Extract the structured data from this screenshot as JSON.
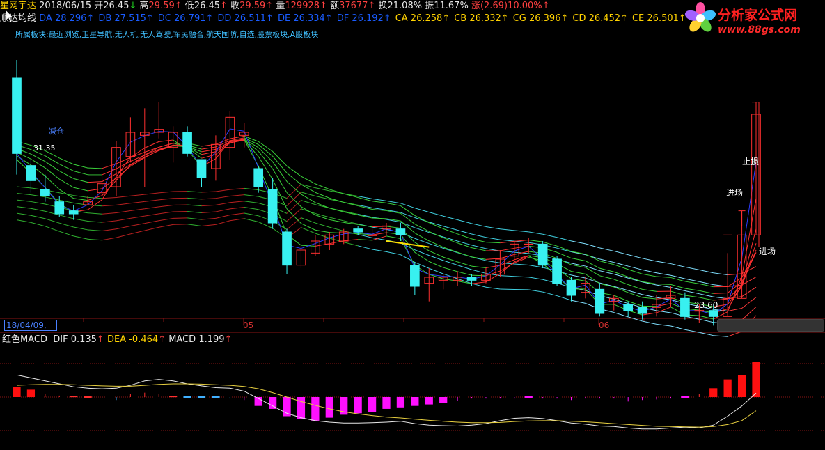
{
  "header": {
    "security_name": "星网宇达",
    "date": "2018/06/15",
    "open_label": "开",
    "open_value": "26.45",
    "high_label": "高",
    "high_value": "29.59",
    "low_label": "低",
    "low_value": "26.45",
    "close_label": "收",
    "close_value": "29.59",
    "volume_label": "量",
    "volume_value": "129928",
    "amount_label": "额",
    "amount_value": "37677",
    "turnover_label": "换",
    "turnover_value": "21.08%",
    "amplitude_label": "振",
    "amplitude_value": "11.67%",
    "change_label": "涨",
    "change_value": "(2.69)10.00%"
  },
  "indicator_line": {
    "name": "顺达均线",
    "items": [
      {
        "label": "DA",
        "value": "28.296"
      },
      {
        "label": "DB",
        "value": "27.515"
      },
      {
        "label": "DC",
        "value": "26.791"
      },
      {
        "label": "DD",
        "value": "26.511"
      },
      {
        "label": "DE",
        "value": "26.334"
      },
      {
        "label": "DF",
        "value": "26.192"
      },
      {
        "label": "CA",
        "value": "26.258"
      },
      {
        "label": "CB",
        "value": "26.332"
      },
      {
        "label": "CG",
        "value": "26.396"
      },
      {
        "label": "CD",
        "value": "26.452"
      },
      {
        "label": "CE",
        "value": "26.501"
      },
      {
        "label": "CF",
        "value": ""
      }
    ]
  },
  "sector_line": "所属板块:最近浏览,卫星导航,无人机,无人驾驶,军民融合,航天国防,自选,股票板块,A股板块",
  "logo": {
    "title": "分析家公式网",
    "url": "www.88gs.com"
  },
  "annotations": {
    "reduce": "减仓",
    "high_price": "31.35",
    "low_price": "23.60",
    "stop_loss": "止损",
    "enter1": "进场",
    "enter2": "进场"
  },
  "time_axis": {
    "cursor_date": "18/04/09,一",
    "month1": "05",
    "month2": "06"
  },
  "macd": {
    "name": "红色MACD",
    "dif_label": "DIF",
    "dif_value": "0.135",
    "dea_label": "DEA",
    "dea_value": "-0.464",
    "macd_label": "MACD",
    "macd_value": "1.199"
  },
  "colors": {
    "up": "#ff3030",
    "down": "#38f0f0",
    "bg": "#000000",
    "divider": "#8a1414",
    "macd_pos": "#ff1010",
    "macd_neg": "#ff10ff"
  },
  "chart_data": {
    "type": "candlestick",
    "price_range": [
      23.0,
      32.0
    ],
    "candles": [
      [
        30.8,
        28.3,
        31.4,
        27.6
      ],
      [
        27.9,
        27.4,
        28.1,
        27.0
      ],
      [
        27.1,
        26.9,
        27.6,
        26.7
      ],
      [
        26.7,
        26.3,
        26.9,
        26.2
      ],
      [
        26.4,
        26.3,
        26.6,
        26.1
      ],
      [
        26.6,
        26.7,
        26.9,
        26.6
      ],
      [
        27.0,
        27.3,
        27.6,
        26.9
      ],
      [
        27.2,
        28.5,
        28.7,
        26.9
      ],
      [
        28.2,
        29.0,
        29.5,
        28.0
      ],
      [
        28.9,
        29.0,
        29.8,
        27.2
      ],
      [
        29.0,
        29.1,
        30.0,
        28.8
      ],
      [
        28.5,
        29.0,
        29.2,
        28.0
      ],
      [
        29.0,
        28.3,
        29.2,
        28.2
      ],
      [
        28.1,
        27.5,
        28.1,
        27.2
      ],
      [
        27.8,
        28.6,
        28.9,
        27.4
      ],
      [
        28.5,
        29.5,
        29.7,
        28.1
      ],
      [
        28.9,
        29.0,
        29.3,
        28.5
      ],
      [
        27.8,
        27.2,
        27.9,
        27.0
      ],
      [
        27.1,
        26.0,
        27.5,
        25.8
      ],
      [
        25.7,
        24.6,
        25.8,
        24.3
      ],
      [
        24.6,
        25.1,
        25.3,
        24.5
      ],
      [
        25.0,
        25.4,
        25.6,
        24.9
      ],
      [
        25.3,
        25.6,
        25.7,
        25.1
      ],
      [
        25.4,
        25.7,
        25.8,
        25.3
      ],
      [
        25.8,
        25.7,
        25.9,
        25.6
      ],
      [
        25.6,
        25.6,
        25.8,
        25.5
      ],
      [
        25.8,
        25.9,
        26.0,
        25.6
      ],
      [
        25.8,
        25.6,
        26.0,
        25.4
      ],
      [
        24.6,
        23.9,
        24.7,
        23.6
      ],
      [
        24.0,
        24.2,
        24.5,
        23.4
      ],
      [
        24.1,
        24.2,
        24.3,
        23.8
      ],
      [
        24.1,
        24.2,
        24.4,
        23.9
      ],
      [
        24.2,
        24.1,
        24.3,
        23.9
      ],
      [
        24.1,
        24.3,
        24.5,
        24.0
      ],
      [
        24.3,
        24.8,
        25.1,
        24.2
      ],
      [
        24.9,
        25.3,
        25.4,
        24.8
      ],
      [
        25.3,
        25.3,
        25.5,
        25.0
      ],
      [
        25.3,
        24.6,
        25.4,
        24.5
      ],
      [
        24.8,
        24.0,
        24.9,
        23.9
      ],
      [
        24.1,
        23.6,
        24.2,
        23.4
      ],
      [
        23.7,
        24.0,
        24.2,
        23.5
      ],
      [
        23.8,
        23.0,
        24.0,
        22.9
      ],
      [
        23.4,
        23.5,
        23.6,
        23.1
      ],
      [
        23.3,
        23.1,
        23.4,
        22.9
      ],
      [
        23.2,
        23.0,
        23.4,
        22.8
      ],
      [
        23.2,
        23.3,
        23.6,
        22.9
      ],
      [
        23.5,
        23.6,
        23.9,
        23.2
      ],
      [
        23.5,
        22.9,
        23.7,
        22.8
      ],
      [
        23.1,
        23.1,
        23.3,
        22.7
      ],
      [
        23.1,
        22.9,
        23.3,
        22.6
      ],
      [
        22.9,
        23.5,
        25.0,
        22.9
      ],
      [
        23.5,
        25.6,
        26.4,
        23.5
      ],
      [
        25.6,
        29.6,
        30.0,
        25.6
      ]
    ],
    "macd_hist": [
      0.35,
      0.25,
      0.1,
      0.05,
      0.02,
      0.0,
      -0.05,
      -0.1,
      0.1,
      0.15,
      0.1,
      0.02,
      -0.02,
      -0.02,
      -0.02,
      -0.05,
      -0.1,
      -0.3,
      -0.4,
      -0.65,
      -0.75,
      -0.8,
      -0.7,
      -0.6,
      -0.55,
      -0.5,
      -0.4,
      -0.35,
      -0.3,
      -0.25,
      -0.2,
      -0.12,
      -0.05,
      -0.05,
      -0.05,
      -0.05,
      -0.02,
      -0.05,
      -0.05,
      -0.1,
      -0.05,
      -0.05,
      -0.05,
      -0.15,
      -0.1,
      -0.08,
      -0.05,
      -0.03,
      0.1,
      0.3,
      0.6,
      0.75,
      1.2
    ],
    "dif": [
      0.75,
      0.65,
      0.55,
      0.45,
      0.35,
      0.3,
      0.28,
      0.3,
      0.4,
      0.55,
      0.6,
      0.55,
      0.45,
      0.38,
      0.32,
      0.3,
      0.2,
      -0.05,
      -0.3,
      -0.55,
      -0.7,
      -0.8,
      -0.85,
      -0.88,
      -0.88,
      -0.87,
      -0.85,
      -0.82,
      -0.9,
      -0.95,
      -0.97,
      -0.98,
      -0.95,
      -0.9,
      -0.8,
      -0.72,
      -0.7,
      -0.73,
      -0.8,
      -0.88,
      -0.92,
      -0.98,
      -1.0,
      -1.05,
      -1.08,
      -1.08,
      -1.05,
      -1.02,
      -1.05,
      -0.95,
      -0.65,
      -0.3,
      0.135
    ],
    "dea": [
      0.4,
      0.42,
      0.43,
      0.43,
      0.42,
      0.4,
      0.38,
      0.37,
      0.37,
      0.4,
      0.43,
      0.45,
      0.45,
      0.44,
      0.42,
      0.4,
      0.36,
      0.28,
      0.15,
      0.0,
      -0.15,
      -0.28,
      -0.4,
      -0.5,
      -0.57,
      -0.63,
      -0.68,
      -0.71,
      -0.75,
      -0.79,
      -0.82,
      -0.85,
      -0.87,
      -0.87,
      -0.86,
      -0.83,
      -0.81,
      -0.8,
      -0.8,
      -0.82,
      -0.84,
      -0.87,
      -0.9,
      -0.93,
      -0.96,
      -0.99,
      -1.0,
      -1.01,
      -1.02,
      -1.0,
      -0.93,
      -0.8,
      -0.464
    ],
    "macd_range": [
      -1.3,
      1.3
    ]
  }
}
